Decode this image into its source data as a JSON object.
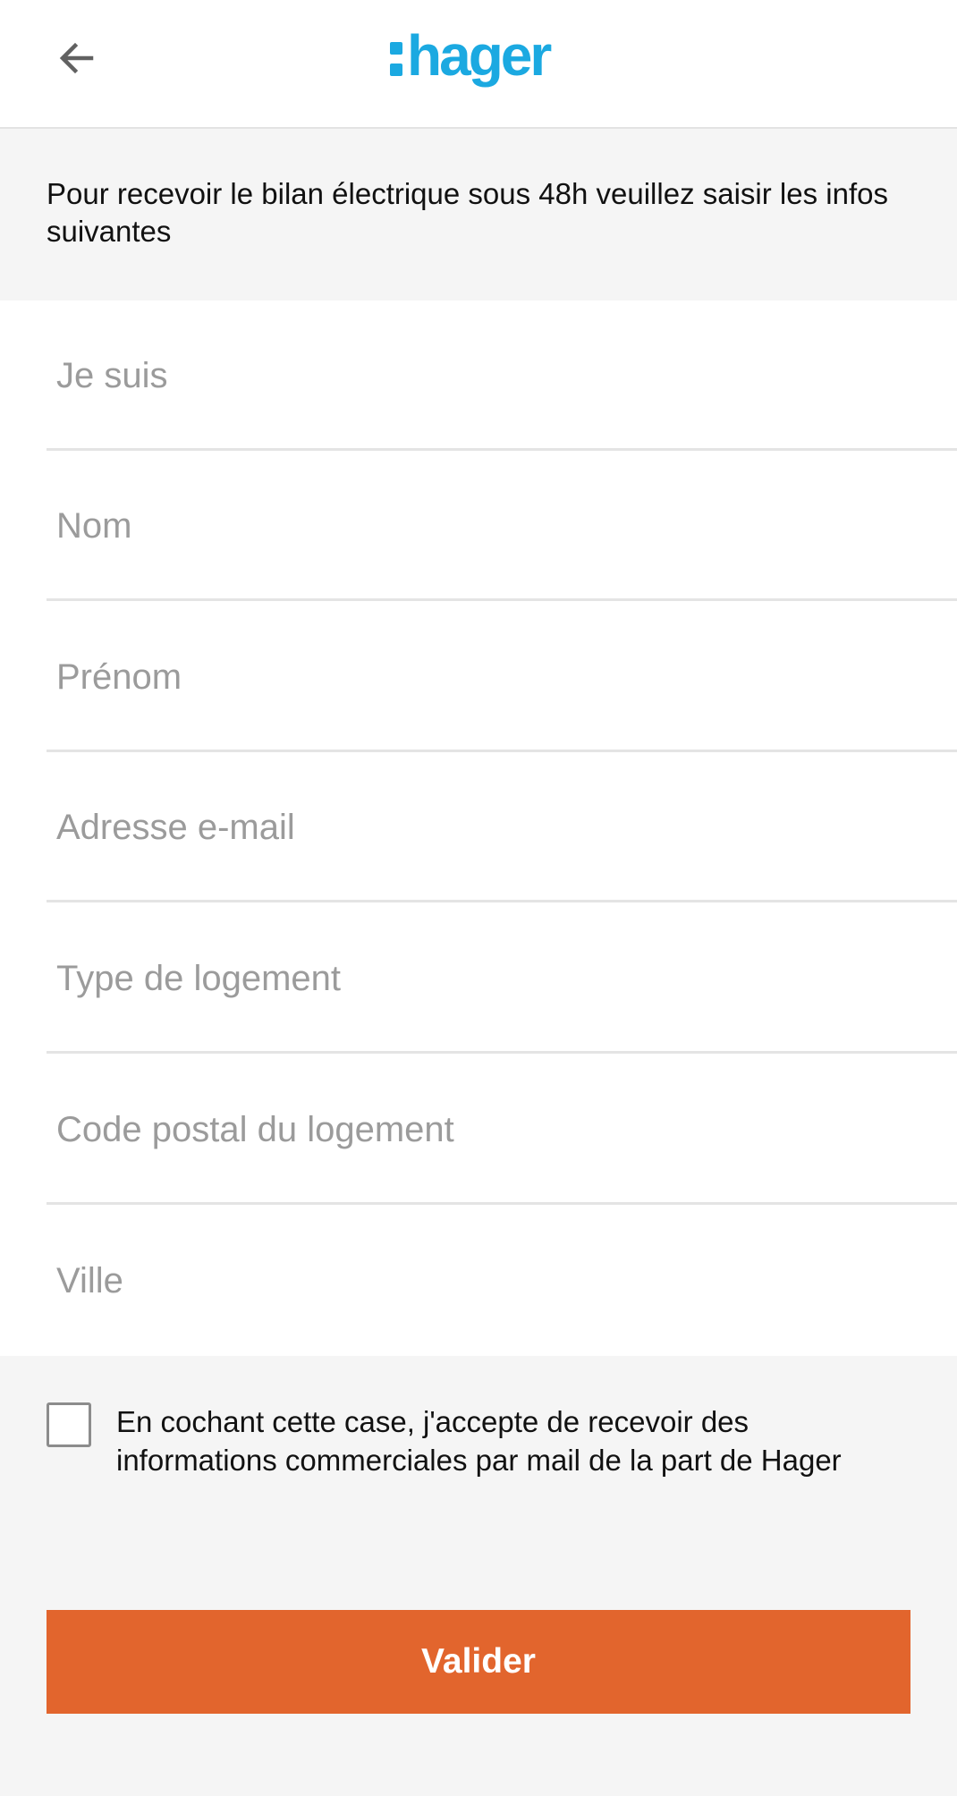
{
  "header": {
    "back_icon": "arrow-left-icon",
    "logo_text": "hager",
    "brand_color": "#1ba9e1"
  },
  "intro": {
    "text": "Pour recevoir le bilan électrique sous 48h veuillez saisir les infos suivantes"
  },
  "form": {
    "fields": [
      {
        "placeholder": "Je suis",
        "value": ""
      },
      {
        "placeholder": "Nom",
        "value": ""
      },
      {
        "placeholder": "Prénom",
        "value": ""
      },
      {
        "placeholder": "Adresse e-mail",
        "value": ""
      },
      {
        "placeholder": "Type de logement",
        "value": ""
      },
      {
        "placeholder": "Code postal du logement",
        "value": ""
      },
      {
        "placeholder": "Ville",
        "value": ""
      }
    ]
  },
  "consent": {
    "checked": false,
    "text": "En cochant cette case, j'accepte de recevoir des informations commerciales par mail de la part de Hager"
  },
  "submit": {
    "label": "Valider",
    "color": "#e2652d"
  }
}
